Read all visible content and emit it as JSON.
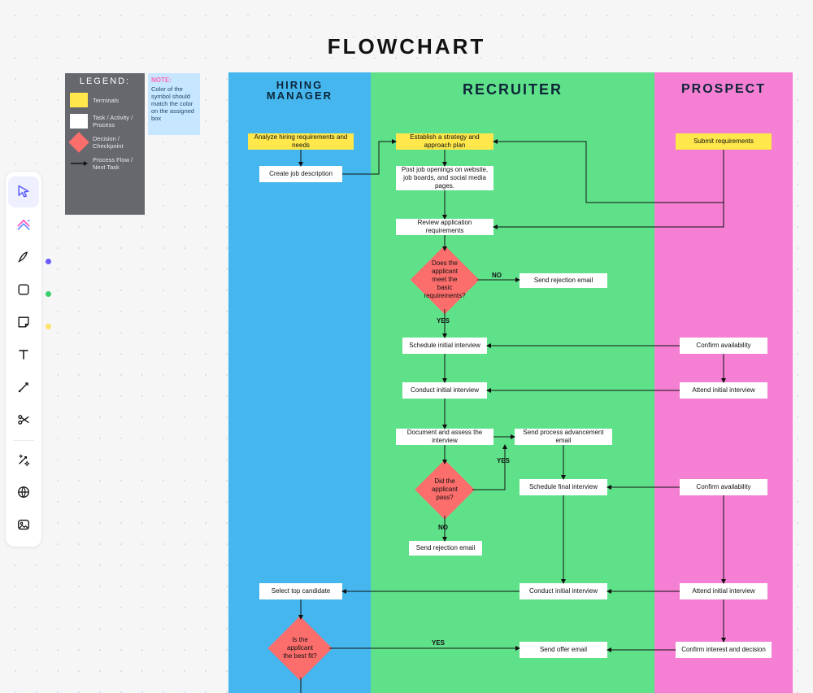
{
  "title": "FLOWCHART",
  "toolbar": {
    "items": [
      {
        "name": "select-tool",
        "icon": "cursor",
        "active": true
      },
      {
        "name": "ai-tool",
        "icon": "sparkle-stack"
      },
      {
        "name": "pen-tool",
        "icon": "pen"
      },
      {
        "name": "shape-tool",
        "icon": "rounded-square"
      },
      {
        "name": "sticky-tool",
        "icon": "sticky-note"
      },
      {
        "name": "text-tool",
        "icon": "text-T"
      },
      {
        "name": "connector-tool",
        "icon": "connector-line"
      },
      {
        "name": "snippet-tool",
        "icon": "scissors"
      },
      {
        "name": "magic-tool",
        "icon": "sparkles"
      },
      {
        "name": "globe-tool",
        "icon": "globe"
      },
      {
        "name": "image-tool",
        "icon": "image"
      }
    ],
    "colorDots": [
      {
        "tool_index": 2,
        "color": "#6b5bff"
      },
      {
        "tool_index": 3,
        "color": "#3dcf6d"
      },
      {
        "tool_index": 4,
        "color": "#ffe26a"
      }
    ]
  },
  "legend": {
    "title": "LEGEND:",
    "rows": [
      {
        "swatch": "#ffe74c",
        "shape": "rect",
        "label": "Terminals"
      },
      {
        "swatch": "#ffffff",
        "shape": "rect",
        "label": "Task / Activity / Process"
      },
      {
        "swatch": "#fb6e6c",
        "shape": "diamond",
        "label": "Decision / Checkpoint"
      },
      {
        "swatch": "#111",
        "shape": "arrow",
        "label": "Process Flow / Next Task"
      }
    ]
  },
  "note": {
    "heading": "NOTE:",
    "body": "Color of the symbol should match the color on the assigned box"
  },
  "lanes": {
    "hm": {
      "label": "HIRING MANAGER"
    },
    "rec": {
      "label": "RECRUITER"
    },
    "pr": {
      "label": "PROSPECT"
    }
  },
  "nodes": {
    "hm_analyze": "Analyze hiring requirements and needs",
    "hm_createjd": "Create job description",
    "rec_strategy": "Establish a strategy and approach plan",
    "rec_post": "Post job openings on website, job boards, and social media pages.",
    "rec_review": "Review application requirements",
    "rec_decision1": "Does the applicant meet the basic requirements?",
    "rec_reject1": "Send rejection email",
    "rec_schedule1": "Schedule initial interview",
    "rec_conduct1": "Conduct initial interview",
    "rec_document": "Document and assess the interview",
    "rec_decision2": "Did the applicant pass?",
    "rec_advance": "Send process advancement email",
    "rec_schedulefinal": "Schedule final interview",
    "rec_reject2": "Send rejection email",
    "rec_conduct2": "Conduct initial interview",
    "rec_offer": "Send offer email",
    "pr_submit": "Submit requirements",
    "pr_confirm1": "Confirm availability",
    "pr_attend1": "Attend initial interview",
    "pr_confirm2": "Confirm availability",
    "pr_attend2": "Attend initial interview",
    "pr_confirm3": "Confirm interest and decision",
    "hm_select": "Select top candidate",
    "hm_decision": "Is the applicant the best fit?"
  },
  "edges": {
    "no": "NO",
    "yes": "YES"
  }
}
